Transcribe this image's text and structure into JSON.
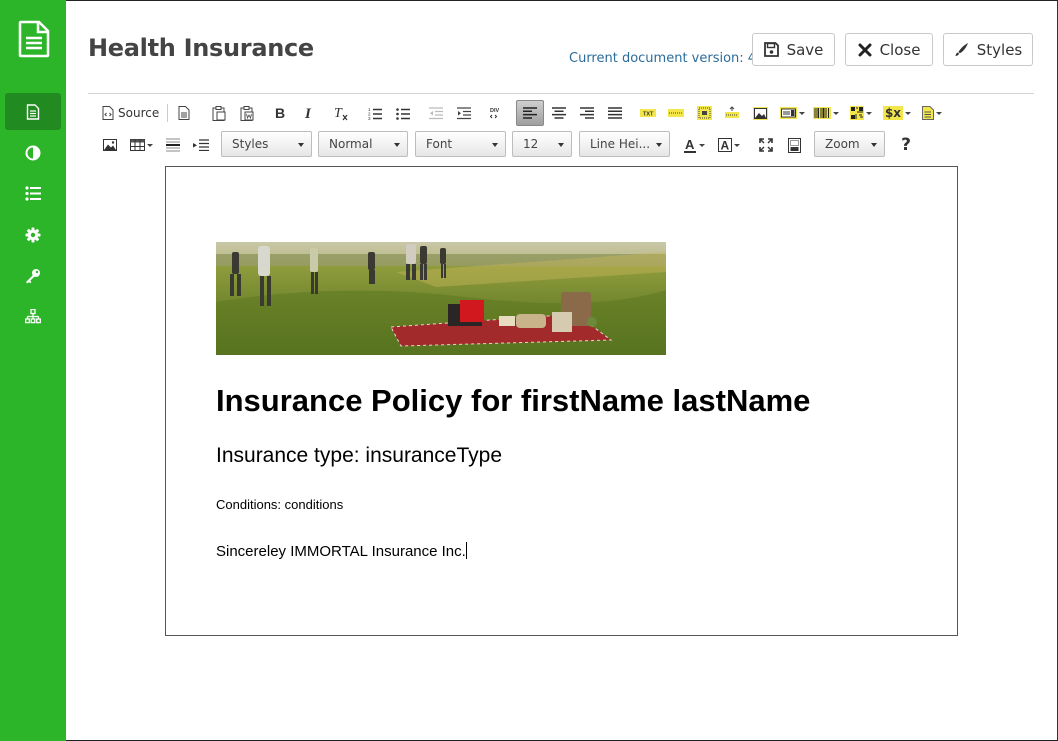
{
  "sidebar": {
    "logo_icon": "document-icon",
    "items": [
      {
        "icon": "file-icon",
        "active": true
      },
      {
        "icon": "contrast-icon",
        "active": false
      },
      {
        "icon": "list-icon",
        "active": false
      },
      {
        "icon": "gear-icon",
        "active": false
      },
      {
        "icon": "key-icon",
        "active": false
      },
      {
        "icon": "sitemap-icon",
        "active": false
      }
    ],
    "color": "#2db52a",
    "active_color": "#218a20"
  },
  "header": {
    "title": "Health Insurance",
    "version_text": "Current document version: 4",
    "save_label": "Save",
    "close_label": "Close",
    "styles_label": "Styles"
  },
  "toolbar": {
    "source_label": "Source",
    "styles_combo": "Styles",
    "format_combo": "Normal",
    "font_combo": "Font",
    "size_combo": "12",
    "lineheight_combo": "Line Hei...",
    "zoom_combo": "Zoom",
    "help_label": "?",
    "txt_label": "TXT",
    "var_label": "$x"
  },
  "document": {
    "image_alt": "picnic-photo",
    "heading": "Insurance Policy for firstName lastName",
    "subheading": "Insurance type: insuranceType",
    "conditions": "Conditions: conditions",
    "signature": "Sincereley IMMORTAL Insurance Inc."
  }
}
